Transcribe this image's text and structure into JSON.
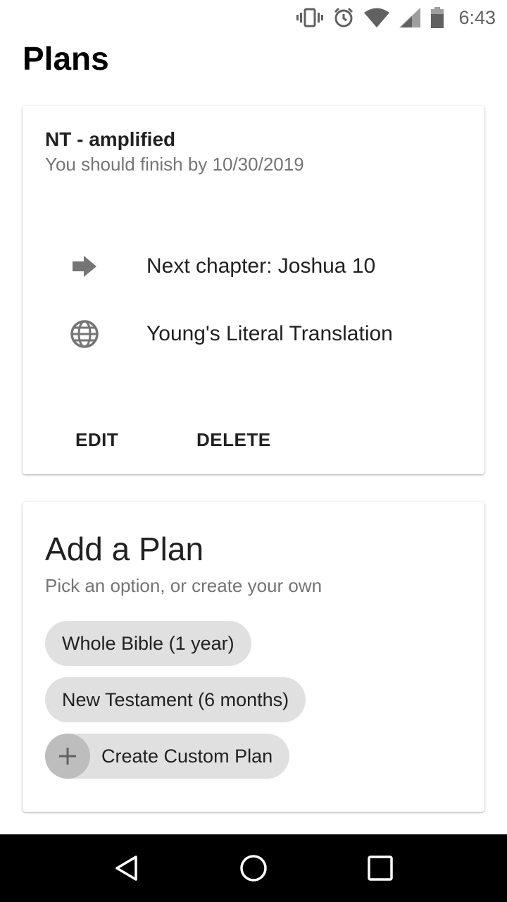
{
  "status_bar": {
    "time": "6:43",
    "icons": [
      "vibrate-icon",
      "alarm-icon",
      "wifi-icon",
      "cell-signal-icon",
      "battery-icon"
    ]
  },
  "page": {
    "title": "Plans"
  },
  "plan_card": {
    "name": "NT - amplified",
    "subtitle": "You should finish by 10/30/2019",
    "next_chapter": "Next chapter: Joshua 10",
    "translation": "Young's Literal Translation",
    "edit_label": "EDIT",
    "delete_label": "DELETE"
  },
  "add_plan": {
    "title": "Add a Plan",
    "subtitle": "Pick an option, or create your own",
    "options": [
      {
        "label": "Whole Bible (1 year)"
      },
      {
        "label": "New Testament (6 months)"
      },
      {
        "label": "Create Custom Plan"
      }
    ]
  },
  "nav": {
    "icons": [
      "back-icon",
      "home-icon",
      "recents-icon"
    ]
  },
  "colors": {
    "chip_bg": "#e0e0e0",
    "icon_gray": "#757575",
    "nav_bg": "#000000"
  }
}
